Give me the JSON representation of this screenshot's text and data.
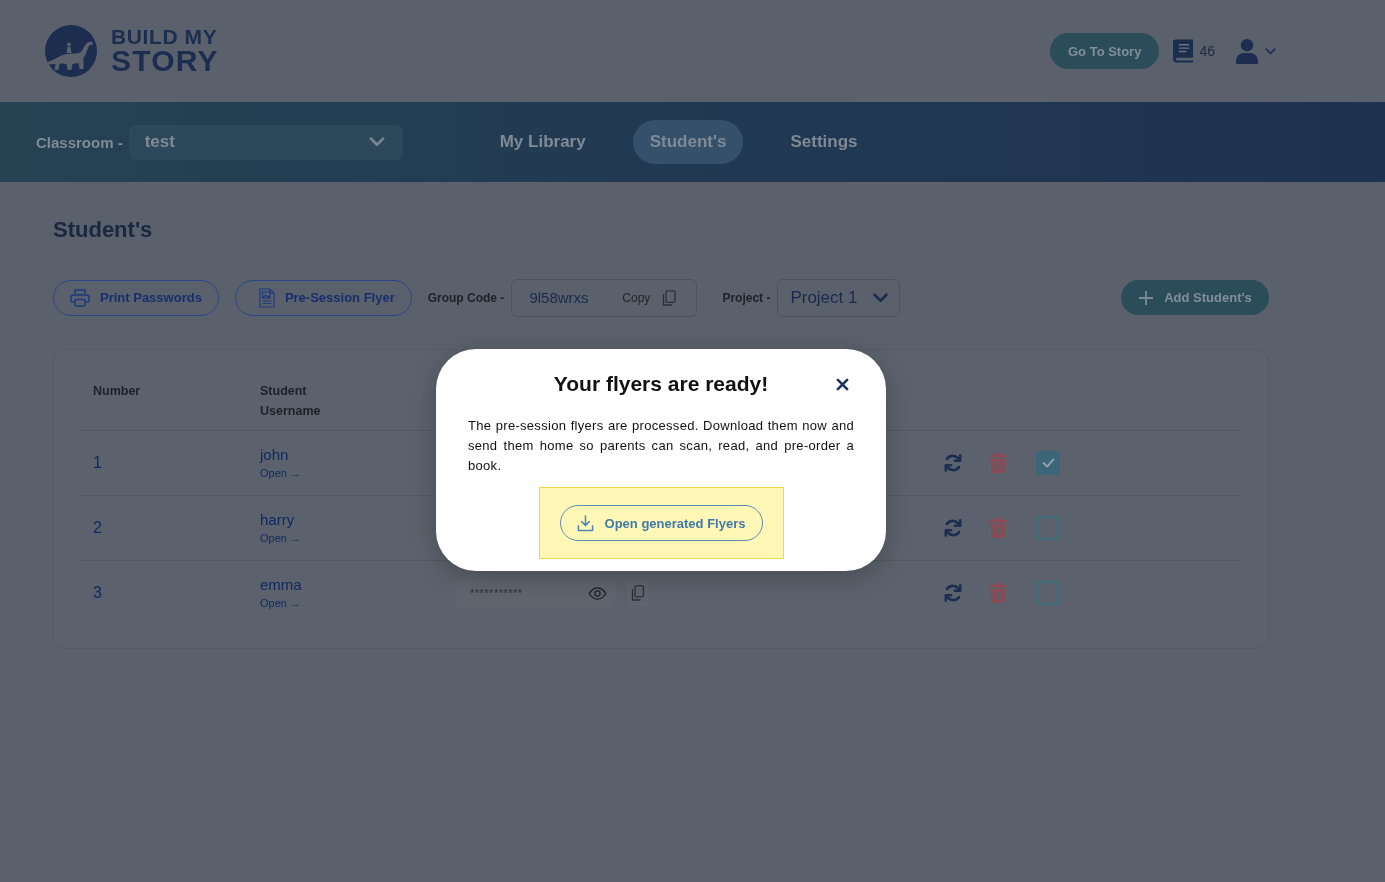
{
  "header": {
    "logo": {
      "line_1": "BUILD MY",
      "line_2": "STORY"
    },
    "go_to_story_button": "Go To Story",
    "book_count": "46"
  },
  "nav": {
    "classroom_label": "Classroom -",
    "classroom_select": "test",
    "tabs": [
      {
        "label": "My Library",
        "selected": false
      },
      {
        "label": "Student's",
        "selected": true
      },
      {
        "label": "Settings",
        "selected": false
      }
    ]
  },
  "page_title": "Student's",
  "toolbar": {
    "print_passwords_button": "Print Passwords",
    "pre_session_flyer_button": "Pre-Session Flyer",
    "group_code_label": "Group Code -",
    "group_code": "9l58wrxs",
    "copy_label": "Copy",
    "project_label": "Project -",
    "project_select": "Project 1",
    "add_students_button": "Add Student's"
  },
  "table": {
    "columns": [
      "Number",
      "Student Username"
    ],
    "rows": [
      {
        "number": "1",
        "username": "john",
        "open_link": "Open →",
        "checked": true
      },
      {
        "number": "2",
        "username": "harry",
        "open_link": "Open →",
        "checked": false
      },
      {
        "number": "3",
        "username": "emma",
        "open_link": "Open →",
        "password": "***********",
        "checked": false
      }
    ]
  },
  "modal": {
    "title": "Your flyers are ready!",
    "body": "The pre-session flyers are processed. Download them now and send them home so parents can scan, read, and pre-order a book.",
    "action": {
      "label": "Open generated Flyers",
      "highlighted": true
    }
  }
}
